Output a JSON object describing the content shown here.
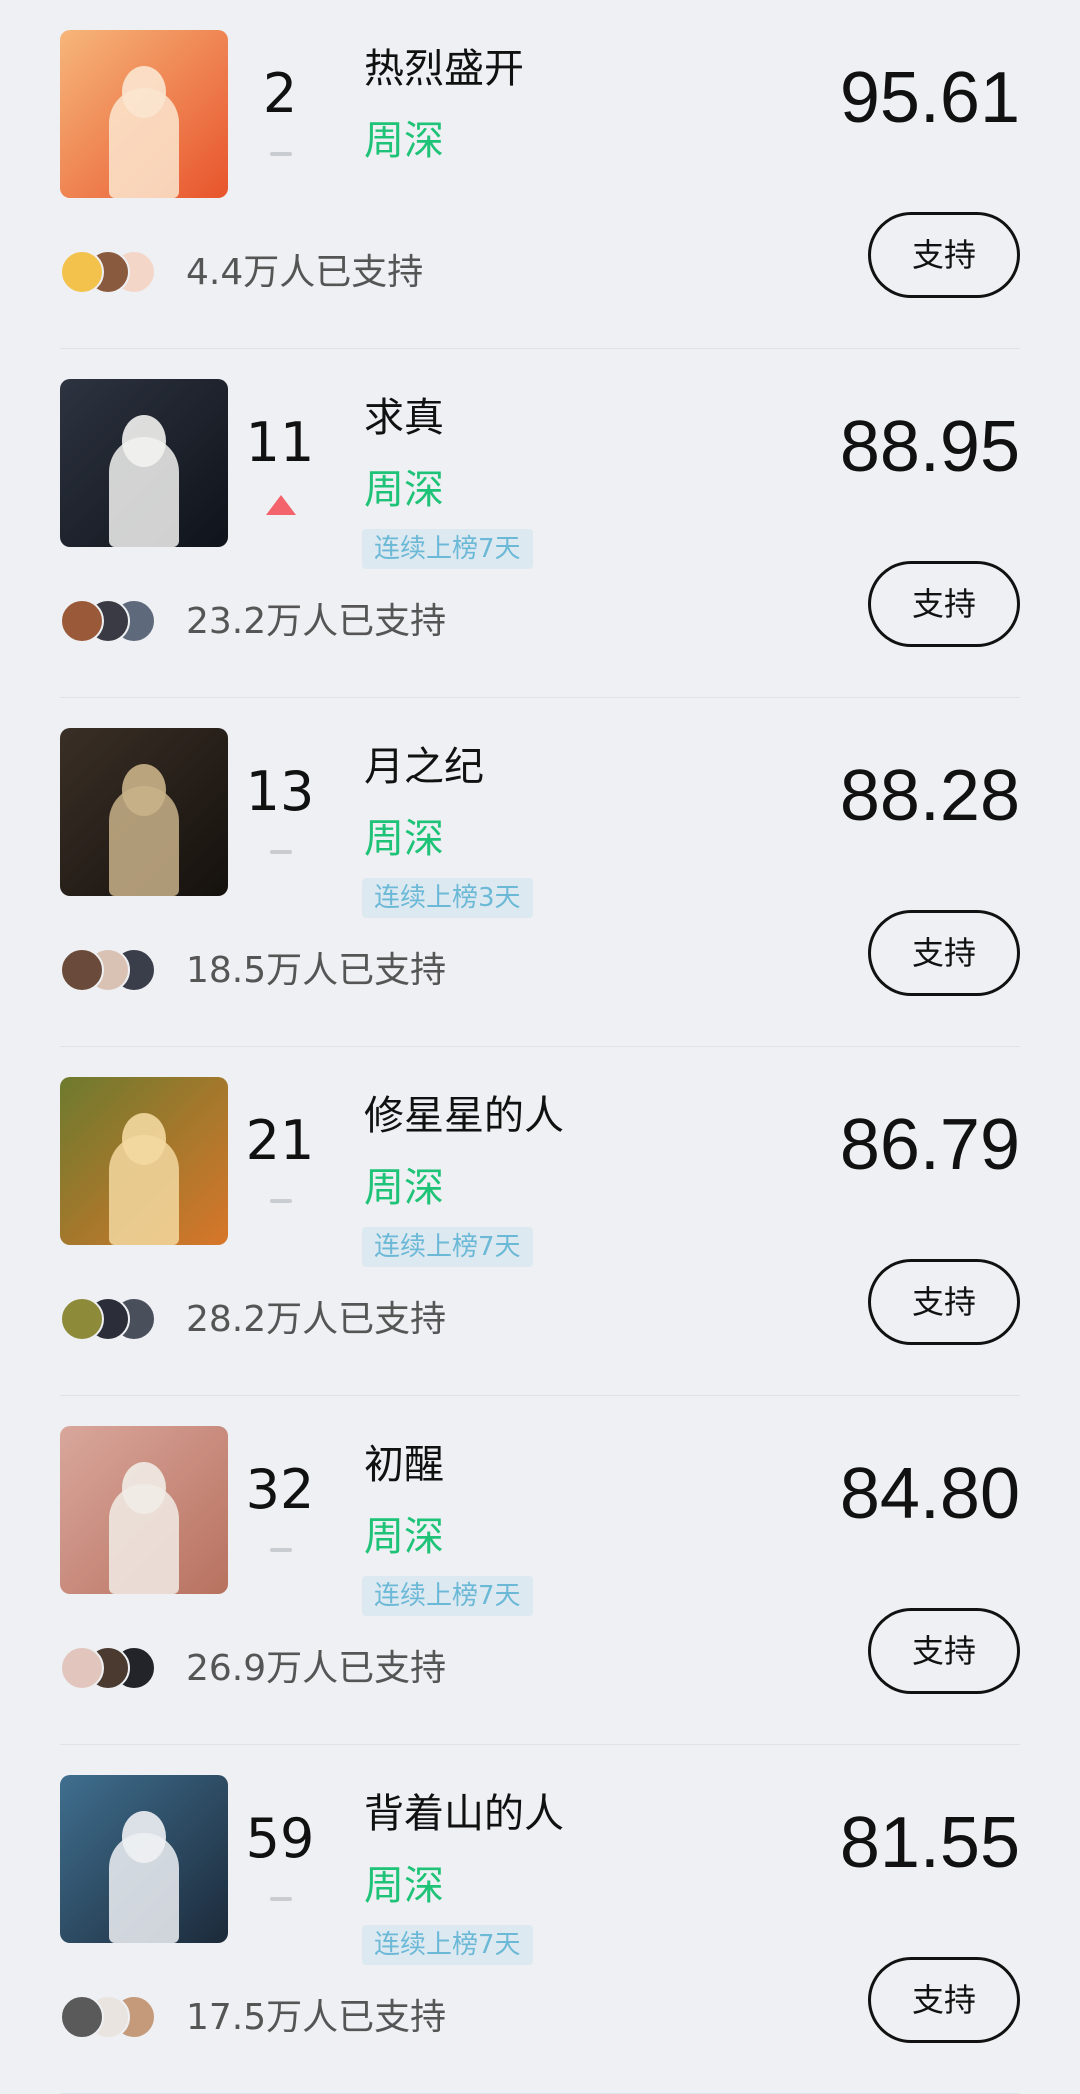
{
  "items": [
    {
      "rank": "2",
      "trend": "same",
      "title": "热烈盛开",
      "artist": "周深",
      "streak": "",
      "score": "95.61",
      "supporters": "4.4万人已支持",
      "button_label": "支持",
      "cover_colors": [
        "#f6b67a",
        "#e8542c",
        "#fbe6cf"
      ],
      "avatar_colors": [
        "#f3c24c",
        "#8a5a3e",
        "#f4d6c8"
      ]
    },
    {
      "rank": "11",
      "trend": "up",
      "title": "求真",
      "artist": "周深",
      "streak": "连续上榜7天",
      "score": "88.95",
      "supporters": "23.2万人已支持",
      "button_label": "支持",
      "cover_colors": [
        "#2d3340",
        "#0f131a",
        "#f2f2f0"
      ],
      "avatar_colors": [
        "#9a5a3a",
        "#3a3a44",
        "#5e6a7c"
      ]
    },
    {
      "rank": "13",
      "trend": "same",
      "title": "月之纪",
      "artist": "周深",
      "streak": "连续上榜3天",
      "score": "88.28",
      "supporters": "18.5万人已支持",
      "button_label": "支持",
      "cover_colors": [
        "#3a2f26",
        "#15110d",
        "#c9b28a"
      ],
      "avatar_colors": [
        "#6a4a3a",
        "#d9c2b4",
        "#3a3d4a"
      ]
    },
    {
      "rank": "21",
      "trend": "same",
      "title": "修星星的人",
      "artist": "周深",
      "streak": "连续上榜7天",
      "score": "86.79",
      "supporters": "28.2万人已支持",
      "button_label": "支持",
      "cover_colors": [
        "#6d7a2e",
        "#d8762a",
        "#f3d8a0"
      ],
      "avatar_colors": [
        "#8d8a3a",
        "#2b2e38",
        "#4a4f5c"
      ]
    },
    {
      "rank": "32",
      "trend": "same",
      "title": "初醒",
      "artist": "周深",
      "streak": "连续上榜7天",
      "score": "84.80",
      "supporters": "26.9万人已支持",
      "button_label": "支持",
      "cover_colors": [
        "#d9a79c",
        "#b8715f",
        "#f1ece6"
      ],
      "avatar_colors": [
        "#e2c6bd",
        "#4a3a30",
        "#22242a"
      ]
    },
    {
      "rank": "59",
      "trend": "same",
      "title": "背着山的人",
      "artist": "周深",
      "streak": "连续上榜7天",
      "score": "81.55",
      "supporters": "17.5万人已支持",
      "button_label": "支持",
      "cover_colors": [
        "#3f6f8f",
        "#1c2a3a",
        "#eef1f4"
      ],
      "avatar_colors": [
        "#5a5a5a",
        "#e9e4e0",
        "#c49a7a"
      ]
    }
  ]
}
